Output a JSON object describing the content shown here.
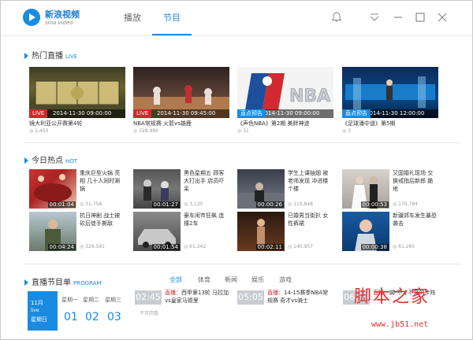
{
  "app": {
    "name": "新浪视频",
    "sub": "sina video"
  },
  "tabs": [
    {
      "label": "播放"
    },
    {
      "label": "节目"
    }
  ],
  "sections": {
    "live": {
      "title": "热门直播",
      "sub": "LIVE"
    },
    "hot": {
      "title": "今日热点",
      "sub": "HOT"
    },
    "schedule": {
      "title": "直播节目单",
      "sub": "PROGRAM"
    }
  },
  "live_cards": [
    {
      "badge": "LIVE",
      "time": "2014-11-30 09:00:00",
      "title": "镜大利亚公开赛第4轮",
      "count": "1,450"
    },
    {
      "badge": "LIVE",
      "time": "2014-11-30 09:45:00",
      "title": "NBA常规赛 火箭vs雄鹿",
      "count": "328,980"
    },
    {
      "badge": "直点预告",
      "time": "2014-11-30 09:00:00",
      "title": "《声色NBA》第2期 美胖神迹",
      "count": "31"
    },
    {
      "badge": "直点预告",
      "time": "2014-11-30 12:00:00",
      "title": "《足球潘中道》第5期",
      "count": "3"
    }
  ],
  "hot_items": [
    {
      "duration": "00:01:04",
      "text": "重庆巨型火锅 亮相 几十人同时涮锅",
      "count": "31,758"
    },
    {
      "duration": "00:01:27",
      "text": "黑色星期五 顾客大打出手 店员吓呆",
      "count": "3,135"
    },
    {
      "duration": "00:00:26",
      "text": "学生上课抽烟 被老师发现 冲进楼个楼",
      "count": "110,848"
    },
    {
      "duration": "00:00:53",
      "text": "又国婚礼现场 交换戒指后新郎 跪地",
      "count": "170,784"
    },
    {
      "duration": "00:04:24",
      "text": "抗日神剧 战士被砍后徒手撕敌",
      "count": "329,591"
    },
    {
      "duration": "00:01:54",
      "text": "豪车闹市狂飙 连撞2车",
      "count": "61,242"
    },
    {
      "duration": "00:02:11",
      "text": "已婚男当街扒 女性裤裙",
      "count": "140,957"
    },
    {
      "duration": "00:00:38",
      "text": "新疆郊车发生暴恐袭击",
      "count": "61,285"
    }
  ],
  "schedule": {
    "filters": [
      "全部",
      "体育",
      "新闻",
      "娱乐",
      "游戏"
    ],
    "month": "11月",
    "month_sub": "live",
    "today": "星期日",
    "weekdays": [
      "星期一",
      "星期二",
      "星期三"
    ],
    "days": [
      "01",
      "02",
      "03"
    ],
    "programs": [
      {
        "time": "02:45",
        "tag": "直播：",
        "title": "西甲第13轮 马拉加vs皇家马德里",
        "status": "不可回看"
      },
      {
        "time": "05:05",
        "tag": "直播：",
        "title": "14-15赛季NBA常规赛 奇才vs骑士"
      },
      {
        "time": "06:00",
        "tag": "直播：",
        "title": "脚-不才不是的步阵"
      }
    ]
  },
  "watermark": {
    "text": "脚本之家",
    "url": "www.jb51.net"
  },
  "colors": {
    "accent": "#1a8be0",
    "live_badge": "#d6262b"
  }
}
